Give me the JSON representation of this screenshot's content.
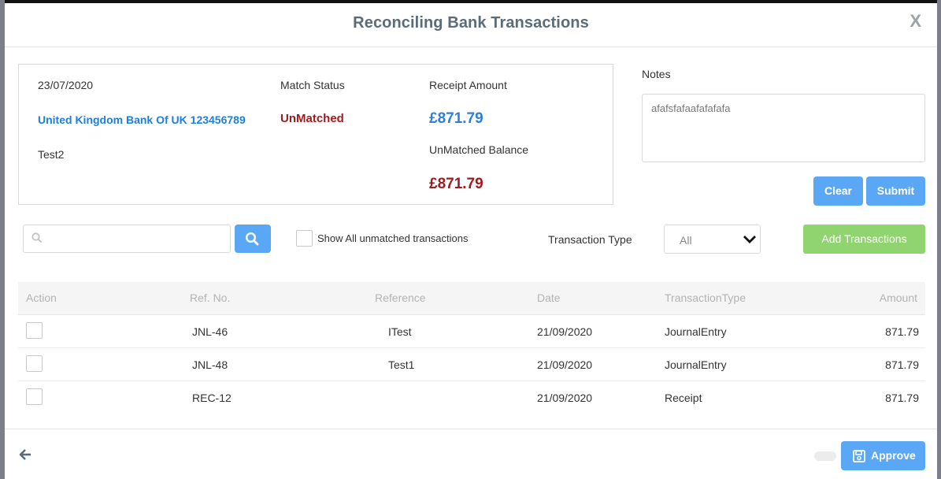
{
  "modal": {
    "title": "Reconciling Bank Transactions",
    "close_glyph": "X"
  },
  "summary": {
    "date": "23/07/2020",
    "bank": "United Kingdom Bank Of UK 123456789",
    "description": "Test2",
    "match_status_label": "Match Status",
    "match_status_value": "UnMatched",
    "receipt_amount_label": "Receipt Amount",
    "receipt_amount_value": "£871.79",
    "unmatched_balance_label": "UnMatched Balance",
    "unmatched_balance_value": "£871.79"
  },
  "notes": {
    "label": "Notes",
    "value": "afafsfafaafafafafa",
    "clear_label": "Clear",
    "submit_label": "Submit"
  },
  "filters": {
    "search_placeholder": "",
    "show_all_label": "Show All unmatched transactions",
    "transaction_type_label": "Transaction Type",
    "transaction_type_value": "All",
    "add_transactions_label": "Add Transactions"
  },
  "table": {
    "headers": {
      "action": "Action",
      "ref_no": "Ref. No.",
      "reference": "Reference",
      "date": "Date",
      "transaction_type": "TransactionType",
      "amount": "Amount"
    },
    "rows": [
      {
        "ref_no": "JNL-46",
        "reference": "ITest",
        "date": "21/09/2020",
        "transaction_type": "JournalEntry",
        "amount": "871.79"
      },
      {
        "ref_no": "JNL-48",
        "reference": "Test1",
        "date": "21/09/2020",
        "transaction_type": "JournalEntry",
        "amount": "871.79"
      },
      {
        "ref_no": "REC-12",
        "reference": "",
        "date": "21/09/2020",
        "transaction_type": "Receipt",
        "amount": "871.79"
      }
    ]
  },
  "footer": {
    "approve_label": "Approve"
  },
  "colors": {
    "primary_blue": "#5aa7f5",
    "link_blue": "#1e7ee0",
    "unmatched_red": "#a01c1c",
    "add_green": "#8fd46e"
  },
  "icons": [
    "close-icon",
    "search-icon",
    "chevron-down-icon",
    "back-arrow-icon",
    "save-icon"
  ]
}
